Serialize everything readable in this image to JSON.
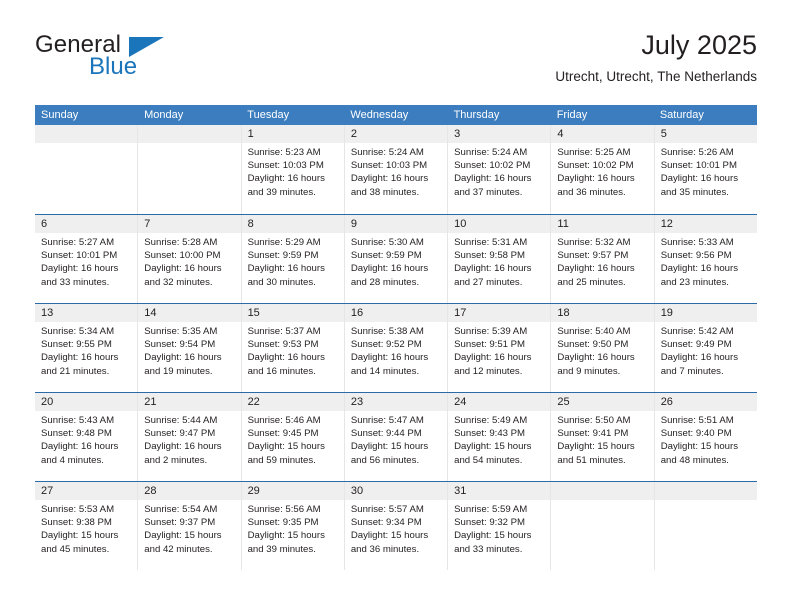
{
  "brand": {
    "name_top": "General",
    "name_bottom": "Blue",
    "accent_color": "#1b75bb",
    "triangle_icon": "brand-triangle-icon"
  },
  "header": {
    "title": "July 2025",
    "subtitle": "Utrecht, Utrecht, The Netherlands"
  },
  "calendar": {
    "header_bg": "#3b7dbf",
    "daynum_bg": "#efefef",
    "row_border": "#2a6ba8",
    "weekdays": [
      "Sunday",
      "Monday",
      "Tuesday",
      "Wednesday",
      "Thursday",
      "Friday",
      "Saturday"
    ],
    "weeks": [
      [
        {
          "day": "",
          "lines": []
        },
        {
          "day": "",
          "lines": []
        },
        {
          "day": "1",
          "lines": [
            "Sunrise: 5:23 AM",
            "Sunset: 10:03 PM",
            "Daylight: 16 hours",
            "and 39 minutes."
          ]
        },
        {
          "day": "2",
          "lines": [
            "Sunrise: 5:24 AM",
            "Sunset: 10:03 PM",
            "Daylight: 16 hours",
            "and 38 minutes."
          ]
        },
        {
          "day": "3",
          "lines": [
            "Sunrise: 5:24 AM",
            "Sunset: 10:02 PM",
            "Daylight: 16 hours",
            "and 37 minutes."
          ]
        },
        {
          "day": "4",
          "lines": [
            "Sunrise: 5:25 AM",
            "Sunset: 10:02 PM",
            "Daylight: 16 hours",
            "and 36 minutes."
          ]
        },
        {
          "day": "5",
          "lines": [
            "Sunrise: 5:26 AM",
            "Sunset: 10:01 PM",
            "Daylight: 16 hours",
            "and 35 minutes."
          ]
        }
      ],
      [
        {
          "day": "6",
          "lines": [
            "Sunrise: 5:27 AM",
            "Sunset: 10:01 PM",
            "Daylight: 16 hours",
            "and 33 minutes."
          ]
        },
        {
          "day": "7",
          "lines": [
            "Sunrise: 5:28 AM",
            "Sunset: 10:00 PM",
            "Daylight: 16 hours",
            "and 32 minutes."
          ]
        },
        {
          "day": "8",
          "lines": [
            "Sunrise: 5:29 AM",
            "Sunset: 9:59 PM",
            "Daylight: 16 hours",
            "and 30 minutes."
          ]
        },
        {
          "day": "9",
          "lines": [
            "Sunrise: 5:30 AM",
            "Sunset: 9:59 PM",
            "Daylight: 16 hours",
            "and 28 minutes."
          ]
        },
        {
          "day": "10",
          "lines": [
            "Sunrise: 5:31 AM",
            "Sunset: 9:58 PM",
            "Daylight: 16 hours",
            "and 27 minutes."
          ]
        },
        {
          "day": "11",
          "lines": [
            "Sunrise: 5:32 AM",
            "Sunset: 9:57 PM",
            "Daylight: 16 hours",
            "and 25 minutes."
          ]
        },
        {
          "day": "12",
          "lines": [
            "Sunrise: 5:33 AM",
            "Sunset: 9:56 PM",
            "Daylight: 16 hours",
            "and 23 minutes."
          ]
        }
      ],
      [
        {
          "day": "13",
          "lines": [
            "Sunrise: 5:34 AM",
            "Sunset: 9:55 PM",
            "Daylight: 16 hours",
            "and 21 minutes."
          ]
        },
        {
          "day": "14",
          "lines": [
            "Sunrise: 5:35 AM",
            "Sunset: 9:54 PM",
            "Daylight: 16 hours",
            "and 19 minutes."
          ]
        },
        {
          "day": "15",
          "lines": [
            "Sunrise: 5:37 AM",
            "Sunset: 9:53 PM",
            "Daylight: 16 hours",
            "and 16 minutes."
          ]
        },
        {
          "day": "16",
          "lines": [
            "Sunrise: 5:38 AM",
            "Sunset: 9:52 PM",
            "Daylight: 16 hours",
            "and 14 minutes."
          ]
        },
        {
          "day": "17",
          "lines": [
            "Sunrise: 5:39 AM",
            "Sunset: 9:51 PM",
            "Daylight: 16 hours",
            "and 12 minutes."
          ]
        },
        {
          "day": "18",
          "lines": [
            "Sunrise: 5:40 AM",
            "Sunset: 9:50 PM",
            "Daylight: 16 hours",
            "and 9 minutes."
          ]
        },
        {
          "day": "19",
          "lines": [
            "Sunrise: 5:42 AM",
            "Sunset: 9:49 PM",
            "Daylight: 16 hours",
            "and 7 minutes."
          ]
        }
      ],
      [
        {
          "day": "20",
          "lines": [
            "Sunrise: 5:43 AM",
            "Sunset: 9:48 PM",
            "Daylight: 16 hours",
            "and 4 minutes."
          ]
        },
        {
          "day": "21",
          "lines": [
            "Sunrise: 5:44 AM",
            "Sunset: 9:47 PM",
            "Daylight: 16 hours",
            "and 2 minutes."
          ]
        },
        {
          "day": "22",
          "lines": [
            "Sunrise: 5:46 AM",
            "Sunset: 9:45 PM",
            "Daylight: 15 hours",
            "and 59 minutes."
          ]
        },
        {
          "day": "23",
          "lines": [
            "Sunrise: 5:47 AM",
            "Sunset: 9:44 PM",
            "Daylight: 15 hours",
            "and 56 minutes."
          ]
        },
        {
          "day": "24",
          "lines": [
            "Sunrise: 5:49 AM",
            "Sunset: 9:43 PM",
            "Daylight: 15 hours",
            "and 54 minutes."
          ]
        },
        {
          "day": "25",
          "lines": [
            "Sunrise: 5:50 AM",
            "Sunset: 9:41 PM",
            "Daylight: 15 hours",
            "and 51 minutes."
          ]
        },
        {
          "day": "26",
          "lines": [
            "Sunrise: 5:51 AM",
            "Sunset: 9:40 PM",
            "Daylight: 15 hours",
            "and 48 minutes."
          ]
        }
      ],
      [
        {
          "day": "27",
          "lines": [
            "Sunrise: 5:53 AM",
            "Sunset: 9:38 PM",
            "Daylight: 15 hours",
            "and 45 minutes."
          ]
        },
        {
          "day": "28",
          "lines": [
            "Sunrise: 5:54 AM",
            "Sunset: 9:37 PM",
            "Daylight: 15 hours",
            "and 42 minutes."
          ]
        },
        {
          "day": "29",
          "lines": [
            "Sunrise: 5:56 AM",
            "Sunset: 9:35 PM",
            "Daylight: 15 hours",
            "and 39 minutes."
          ]
        },
        {
          "day": "30",
          "lines": [
            "Sunrise: 5:57 AM",
            "Sunset: 9:34 PM",
            "Daylight: 15 hours",
            "and 36 minutes."
          ]
        },
        {
          "day": "31",
          "lines": [
            "Sunrise: 5:59 AM",
            "Sunset: 9:32 PM",
            "Daylight: 15 hours",
            "and 33 minutes."
          ]
        },
        {
          "day": "",
          "lines": []
        },
        {
          "day": "",
          "lines": []
        }
      ]
    ]
  }
}
